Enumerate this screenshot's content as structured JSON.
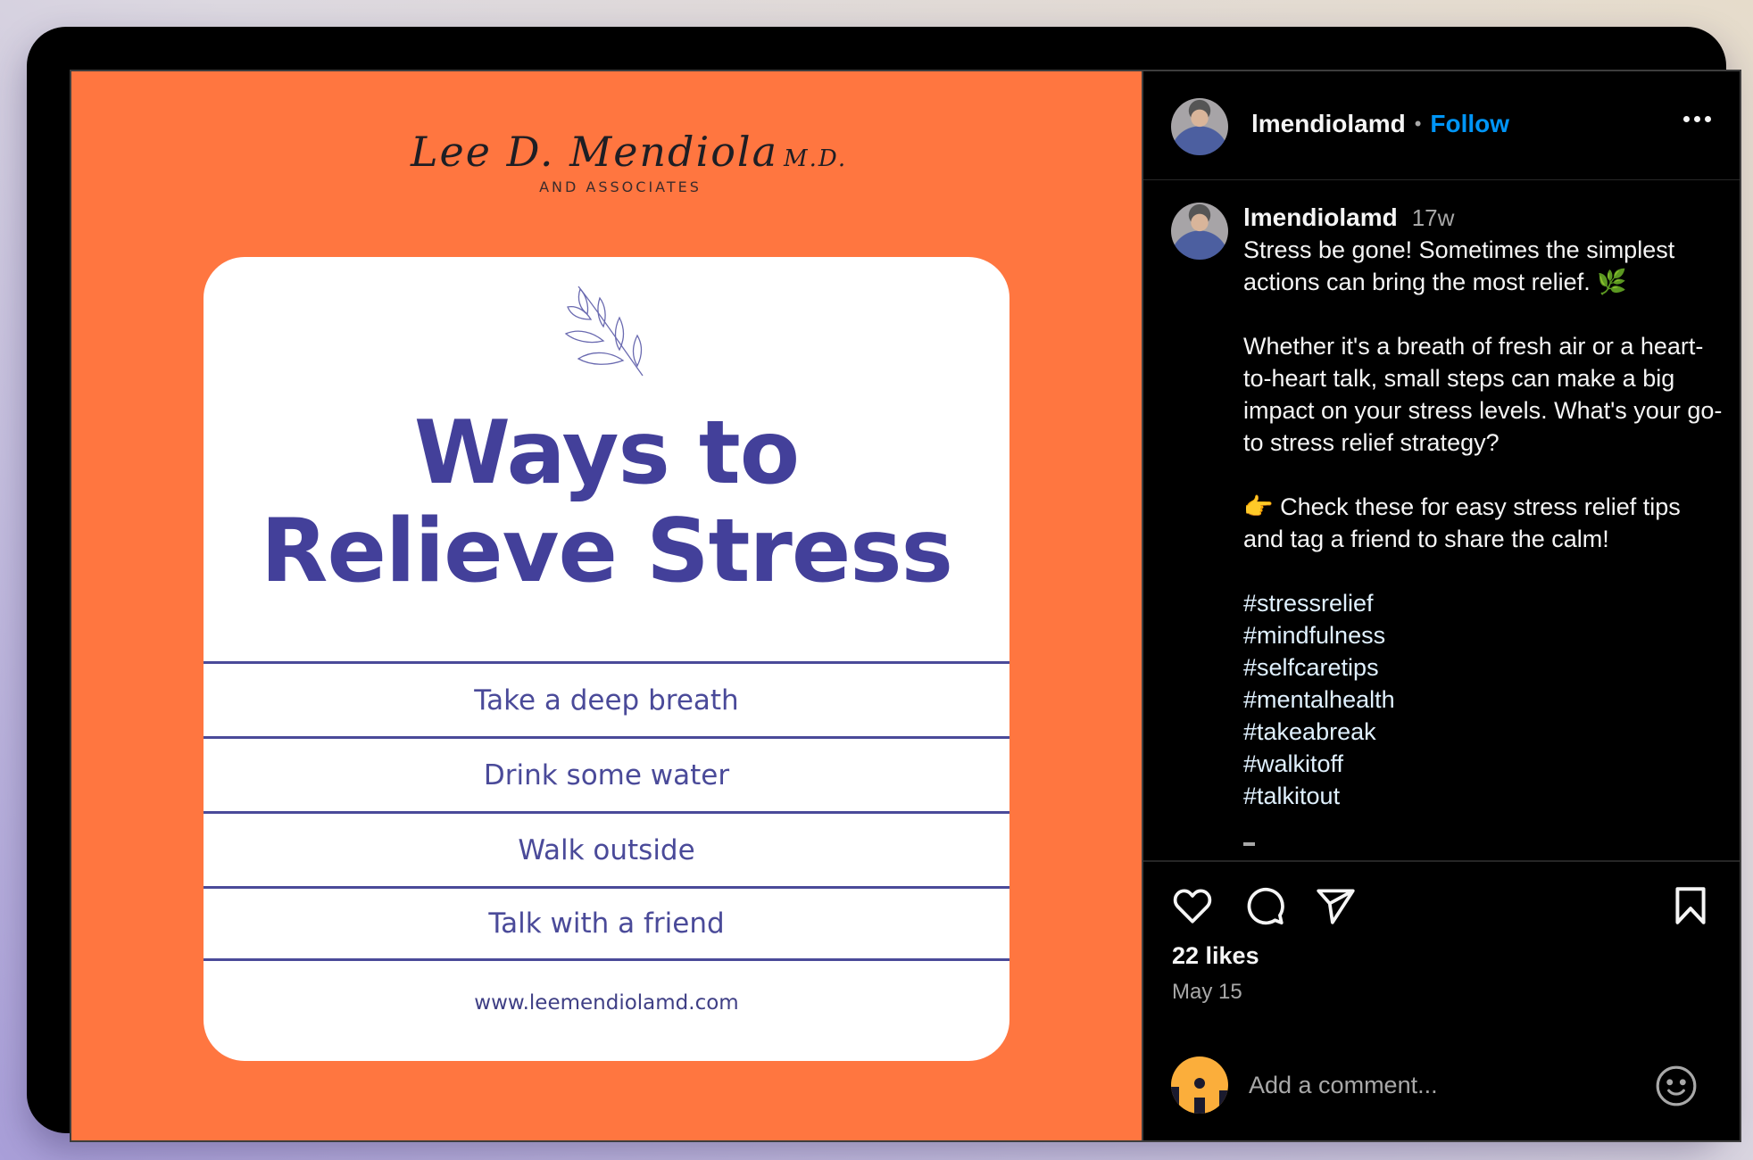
{
  "image": {
    "logo_script": "Lee D. Mendiola",
    "logo_suffix": "M.D.",
    "logo_subtitle": "AND ASSOCIATES",
    "title_line1": "Ways to",
    "title_line2": "Relieve Stress",
    "tips": [
      "Take a deep breath",
      "Drink some water",
      "Walk outside",
      "Talk with a friend"
    ],
    "url": "www.leemendiolamd.com",
    "colors": {
      "background": "#ff7640",
      "card": "#ffffff",
      "accent": "#43409a"
    }
  },
  "header": {
    "username": "lmendiolamd",
    "separator": "•",
    "follow_label": "Follow",
    "more_icon": "more-horizontal-icon"
  },
  "caption": {
    "username": "lmendiolamd",
    "age": "17w",
    "paragraph1": "Stress be gone! Sometimes the simplest actions can bring the most relief. 🌿",
    "paragraph2": "Whether it's a breath of fresh air or a heart-to-heart talk, small steps can make a big impact on your stress levels. What's your go-to stress relief strategy?",
    "paragraph3": "👉 Check these for easy stress relief tips and tag a friend to share the calm!",
    "hashtags": [
      "#stressrelief",
      "#mindfulness",
      "#selfcaretips",
      "#mentalhealth",
      "#takeabreak",
      "#walkitoff",
      "#talkitout"
    ]
  },
  "actions": {
    "like_icon": "heart-icon",
    "comment_icon": "comment-bubble-icon",
    "share_icon": "paper-plane-icon",
    "save_icon": "bookmark-icon"
  },
  "likes_text": "22 likes",
  "date_text": "May 15",
  "comment": {
    "placeholder": "Add a comment...",
    "emoji_icon": "smiley-icon"
  },
  "colors": {
    "panel_bg": "#000000",
    "primary_text": "#f5f5f5",
    "secondary_text": "#a8a8a8",
    "link_blue": "#0095f6",
    "hashtag": "#e0f1ff"
  }
}
